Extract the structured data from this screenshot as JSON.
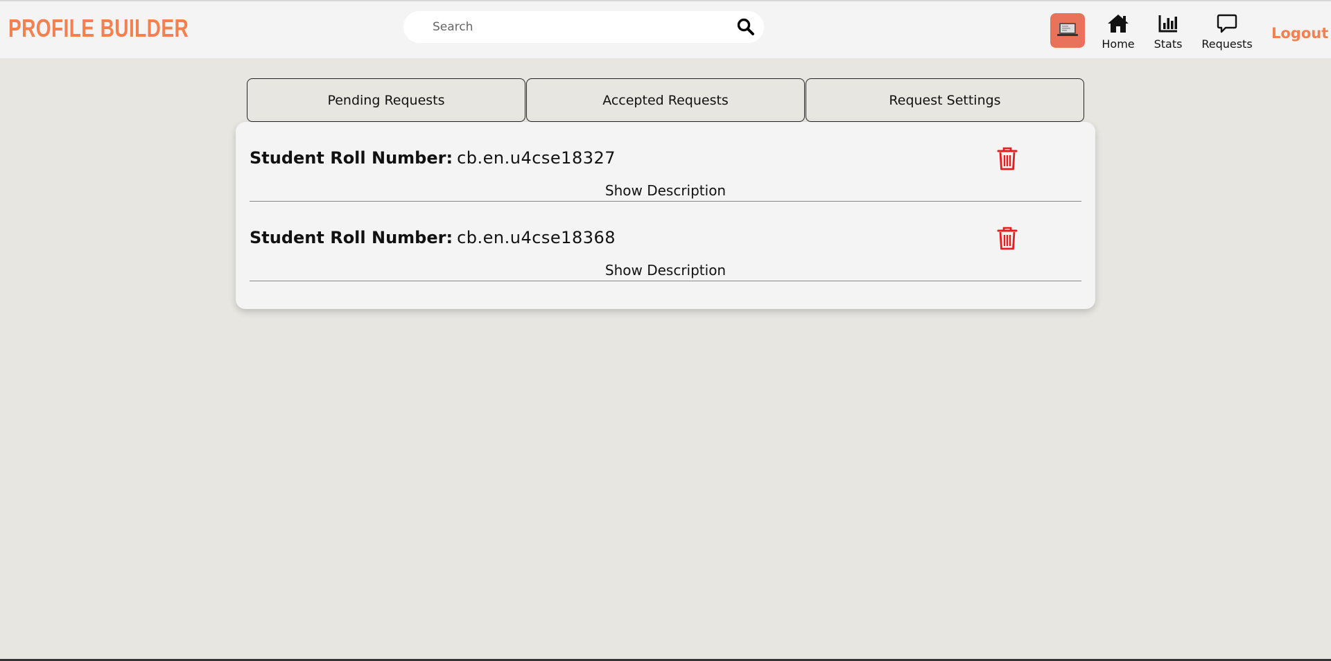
{
  "header": {
    "logo": "PROFILE BUILDER",
    "search": {
      "placeholder": "Search"
    },
    "nav": [
      {
        "label": "Home",
        "icon": "home-icon"
      },
      {
        "label": "Stats",
        "icon": "stats-icon"
      },
      {
        "label": "Requests",
        "icon": "chat-icon"
      }
    ],
    "logout_label": "Logout"
  },
  "tabs": [
    "Pending Requests",
    "Accepted Requests",
    "Request Settings"
  ],
  "requests": [
    {
      "label": "Student Roll Number:",
      "value": "cb.en.u4cse18327",
      "action": "Show Description"
    },
    {
      "label": "Student Roll Number:",
      "value": "cb.en.u4cse18368",
      "action": "Show Description"
    }
  ],
  "colors": {
    "accent": "#f47f4f",
    "avatar_bg": "#e8735a",
    "delete": "#e81c1c",
    "background": "#e7e6e1",
    "surface": "#f4f4f4"
  }
}
